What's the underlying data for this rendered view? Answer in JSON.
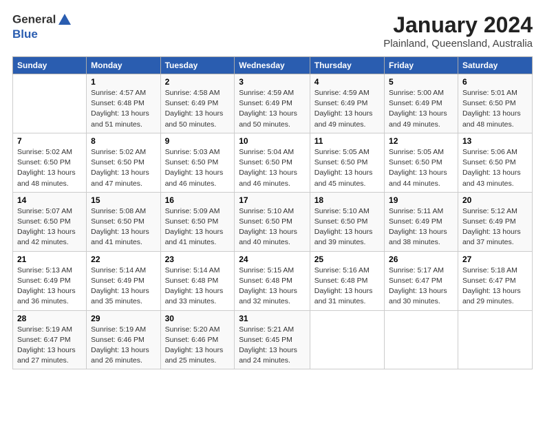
{
  "header": {
    "logo_line1": "General",
    "logo_line2": "Blue",
    "month": "January 2024",
    "location": "Plainland, Queensland, Australia"
  },
  "weekdays": [
    "Sunday",
    "Monday",
    "Tuesday",
    "Wednesday",
    "Thursday",
    "Friday",
    "Saturday"
  ],
  "weeks": [
    [
      {
        "day": "",
        "sunrise": "",
        "sunset": "",
        "daylight": ""
      },
      {
        "day": "1",
        "sunrise": "Sunrise: 4:57 AM",
        "sunset": "Sunset: 6:48 PM",
        "daylight": "Daylight: 13 hours and 51 minutes."
      },
      {
        "day": "2",
        "sunrise": "Sunrise: 4:58 AM",
        "sunset": "Sunset: 6:49 PM",
        "daylight": "Daylight: 13 hours and 50 minutes."
      },
      {
        "day": "3",
        "sunrise": "Sunrise: 4:59 AM",
        "sunset": "Sunset: 6:49 PM",
        "daylight": "Daylight: 13 hours and 50 minutes."
      },
      {
        "day": "4",
        "sunrise": "Sunrise: 4:59 AM",
        "sunset": "Sunset: 6:49 PM",
        "daylight": "Daylight: 13 hours and 49 minutes."
      },
      {
        "day": "5",
        "sunrise": "Sunrise: 5:00 AM",
        "sunset": "Sunset: 6:49 PM",
        "daylight": "Daylight: 13 hours and 49 minutes."
      },
      {
        "day": "6",
        "sunrise": "Sunrise: 5:01 AM",
        "sunset": "Sunset: 6:50 PM",
        "daylight": "Daylight: 13 hours and 48 minutes."
      }
    ],
    [
      {
        "day": "7",
        "sunrise": "Sunrise: 5:02 AM",
        "sunset": "Sunset: 6:50 PM",
        "daylight": "Daylight: 13 hours and 48 minutes."
      },
      {
        "day": "8",
        "sunrise": "Sunrise: 5:02 AM",
        "sunset": "Sunset: 6:50 PM",
        "daylight": "Daylight: 13 hours and 47 minutes."
      },
      {
        "day": "9",
        "sunrise": "Sunrise: 5:03 AM",
        "sunset": "Sunset: 6:50 PM",
        "daylight": "Daylight: 13 hours and 46 minutes."
      },
      {
        "day": "10",
        "sunrise": "Sunrise: 5:04 AM",
        "sunset": "Sunset: 6:50 PM",
        "daylight": "Daylight: 13 hours and 46 minutes."
      },
      {
        "day": "11",
        "sunrise": "Sunrise: 5:05 AM",
        "sunset": "Sunset: 6:50 PM",
        "daylight": "Daylight: 13 hours and 45 minutes."
      },
      {
        "day": "12",
        "sunrise": "Sunrise: 5:05 AM",
        "sunset": "Sunset: 6:50 PM",
        "daylight": "Daylight: 13 hours and 44 minutes."
      },
      {
        "day": "13",
        "sunrise": "Sunrise: 5:06 AM",
        "sunset": "Sunset: 6:50 PM",
        "daylight": "Daylight: 13 hours and 43 minutes."
      }
    ],
    [
      {
        "day": "14",
        "sunrise": "Sunrise: 5:07 AM",
        "sunset": "Sunset: 6:50 PM",
        "daylight": "Daylight: 13 hours and 42 minutes."
      },
      {
        "day": "15",
        "sunrise": "Sunrise: 5:08 AM",
        "sunset": "Sunset: 6:50 PM",
        "daylight": "Daylight: 13 hours and 41 minutes."
      },
      {
        "day": "16",
        "sunrise": "Sunrise: 5:09 AM",
        "sunset": "Sunset: 6:50 PM",
        "daylight": "Daylight: 13 hours and 41 minutes."
      },
      {
        "day": "17",
        "sunrise": "Sunrise: 5:10 AM",
        "sunset": "Sunset: 6:50 PM",
        "daylight": "Daylight: 13 hours and 40 minutes."
      },
      {
        "day": "18",
        "sunrise": "Sunrise: 5:10 AM",
        "sunset": "Sunset: 6:50 PM",
        "daylight": "Daylight: 13 hours and 39 minutes."
      },
      {
        "day": "19",
        "sunrise": "Sunrise: 5:11 AM",
        "sunset": "Sunset: 6:49 PM",
        "daylight": "Daylight: 13 hours and 38 minutes."
      },
      {
        "day": "20",
        "sunrise": "Sunrise: 5:12 AM",
        "sunset": "Sunset: 6:49 PM",
        "daylight": "Daylight: 13 hours and 37 minutes."
      }
    ],
    [
      {
        "day": "21",
        "sunrise": "Sunrise: 5:13 AM",
        "sunset": "Sunset: 6:49 PM",
        "daylight": "Daylight: 13 hours and 36 minutes."
      },
      {
        "day": "22",
        "sunrise": "Sunrise: 5:14 AM",
        "sunset": "Sunset: 6:49 PM",
        "daylight": "Daylight: 13 hours and 35 minutes."
      },
      {
        "day": "23",
        "sunrise": "Sunrise: 5:14 AM",
        "sunset": "Sunset: 6:48 PM",
        "daylight": "Daylight: 13 hours and 33 minutes."
      },
      {
        "day": "24",
        "sunrise": "Sunrise: 5:15 AM",
        "sunset": "Sunset: 6:48 PM",
        "daylight": "Daylight: 13 hours and 32 minutes."
      },
      {
        "day": "25",
        "sunrise": "Sunrise: 5:16 AM",
        "sunset": "Sunset: 6:48 PM",
        "daylight": "Daylight: 13 hours and 31 minutes."
      },
      {
        "day": "26",
        "sunrise": "Sunrise: 5:17 AM",
        "sunset": "Sunset: 6:47 PM",
        "daylight": "Daylight: 13 hours and 30 minutes."
      },
      {
        "day": "27",
        "sunrise": "Sunrise: 5:18 AM",
        "sunset": "Sunset: 6:47 PM",
        "daylight": "Daylight: 13 hours and 29 minutes."
      }
    ],
    [
      {
        "day": "28",
        "sunrise": "Sunrise: 5:19 AM",
        "sunset": "Sunset: 6:47 PM",
        "daylight": "Daylight: 13 hours and 27 minutes."
      },
      {
        "day": "29",
        "sunrise": "Sunrise: 5:19 AM",
        "sunset": "Sunset: 6:46 PM",
        "daylight": "Daylight: 13 hours and 26 minutes."
      },
      {
        "day": "30",
        "sunrise": "Sunrise: 5:20 AM",
        "sunset": "Sunset: 6:46 PM",
        "daylight": "Daylight: 13 hours and 25 minutes."
      },
      {
        "day": "31",
        "sunrise": "Sunrise: 5:21 AM",
        "sunset": "Sunset: 6:45 PM",
        "daylight": "Daylight: 13 hours and 24 minutes."
      },
      {
        "day": "",
        "sunrise": "",
        "sunset": "",
        "daylight": ""
      },
      {
        "day": "",
        "sunrise": "",
        "sunset": "",
        "daylight": ""
      },
      {
        "day": "",
        "sunrise": "",
        "sunset": "",
        "daylight": ""
      }
    ]
  ]
}
